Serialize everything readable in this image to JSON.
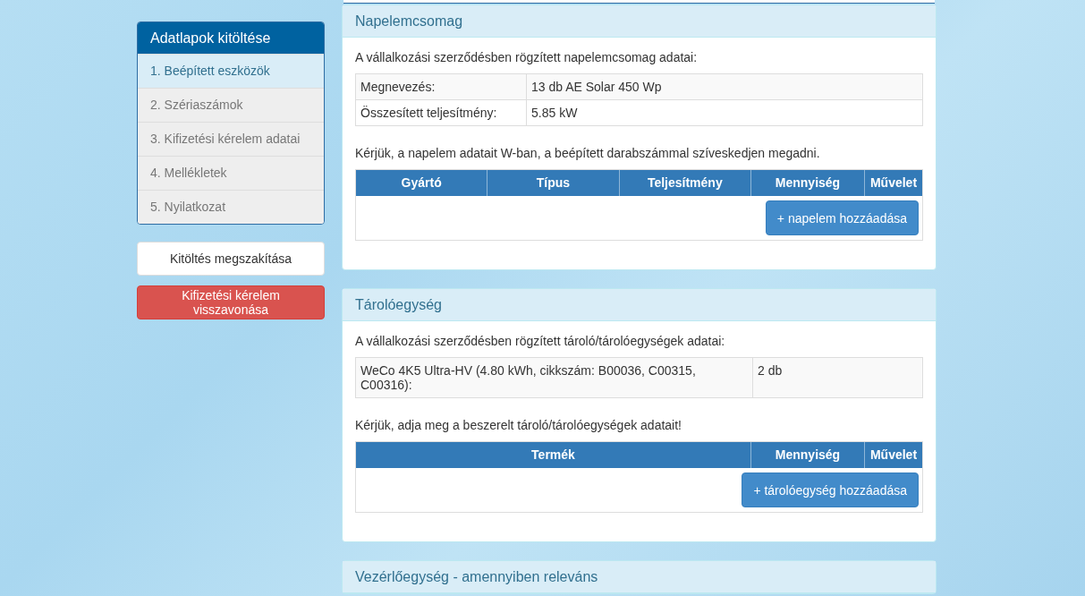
{
  "sidebar": {
    "title": "Adatlapok kitöltése",
    "items": [
      {
        "label": "1. Beépített eszközök",
        "selected": true
      },
      {
        "label": "2. Szériaszámok",
        "selected": false
      },
      {
        "label": "3. Kifizetési kérelem adatai",
        "selected": false
      },
      {
        "label": "4. Mellékletek",
        "selected": false
      },
      {
        "label": "5. Nyilatkozat",
        "selected": false
      }
    ],
    "buttons": [
      {
        "label": "Kitöltés megszakítása",
        "kind": "default"
      },
      {
        "label": "Kifizetési kérelem visszavonása",
        "kind": "danger"
      }
    ]
  },
  "panels": [
    {
      "title": "Napelemcsomag",
      "intro": "A vállalkozási szerződésben rögzített napelemcsomag adatai:",
      "info": {
        "kind": "pairs",
        "rows": [
          [
            "Megnevezés:",
            "13 db AE Solar 450 Wp"
          ],
          [
            "Összesített teljesítmény:",
            "5.85 kW"
          ]
        ]
      },
      "instruction": "Kérjük, a napelem adatait W-ban, a beépített darabszámmal szíveskedjen megadni.",
      "columns": [
        "Gyártó",
        "Típus",
        "Teljesítmény",
        "Mennyiség",
        "Művelet"
      ],
      "add_button": "+ napelem hozzáadása"
    },
    {
      "title": "Tárolóegység",
      "intro": "A vállalkozási szerződésben rögzített tároló/tárolóegységek adatai:",
      "info": {
        "kind": "items",
        "rows": [
          [
            "WeCo 4K5 Ultra-HV (4.80 kWh, cikkszám: B00036, C00315, C00316):",
            "2 db"
          ]
        ]
      },
      "instruction": "Kérjük, adja meg a beszerelt tároló/tárolóegységek adatait!",
      "columns": [
        "Termék",
        "Mennyiség",
        "Művelet"
      ],
      "add_button": "+ tárolóegység hozzáadása"
    },
    {
      "title": "Vezérlőegység - amennyiben releváns"
    }
  ]
}
